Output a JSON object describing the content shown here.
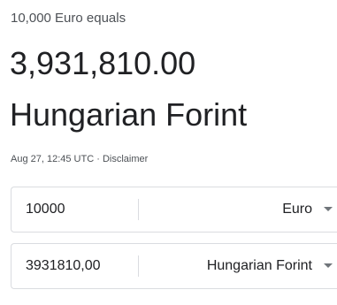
{
  "converter": {
    "equals_text": "10,000 Euro equals",
    "result_amount": "3,931,810.00",
    "result_currency": "Hungarian Forint",
    "timestamp": "Aug 27, 12:45 UTC",
    "separator": " · ",
    "disclaimer": "Disclaimer"
  },
  "from": {
    "amount": "10000",
    "currency": "Euro"
  },
  "to": {
    "amount": "3931810,00",
    "currency": "Hungarian Forint"
  },
  "icons": {
    "dropdown": "caret-down-icon"
  },
  "colors": {
    "text_primary": "#202124",
    "text_secondary": "#4d5156",
    "border": "#dadce0",
    "caret": "#70757a"
  }
}
